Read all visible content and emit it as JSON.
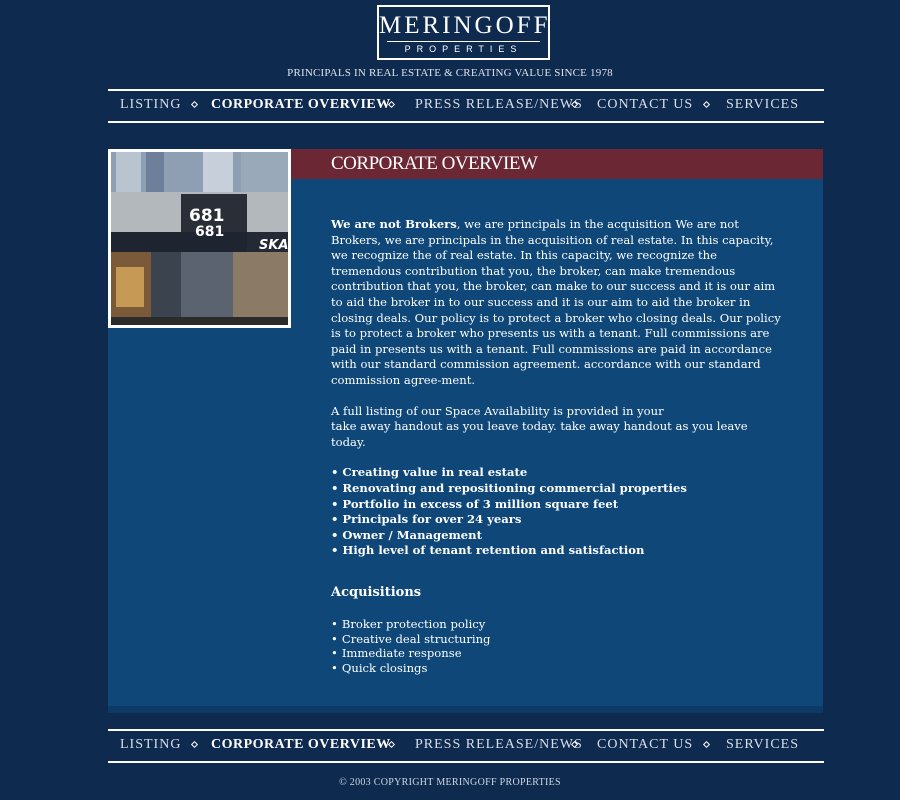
{
  "brand": {
    "name": "MERINGOFF",
    "subname": "PROPERTIES",
    "tagline": "PRINCIPALS IN REAL ESTATE & CREATING VALUE SINCE 1978"
  },
  "nav": {
    "items": [
      {
        "label": "LISTING",
        "active": false
      },
      {
        "label": "CORPORATE OVERVIEW",
        "active": true
      },
      {
        "label": "PRESS RELEASE/NEWS",
        "active": false
      },
      {
        "label": "CONTACT US",
        "active": false
      },
      {
        "label": "SERVICES",
        "active": false
      }
    ]
  },
  "page": {
    "title": "CORPORATE OVERVIEW",
    "intro_bold": "We are not Brokers",
    "intro_text": ", we are principals in the acquisition We are not Brokers, we are principals in the acquisition of real estate. In this capacity, we recognize the of real estate. In this capacity, we recognize the tremendous contribution that you, the broker, can make tremendous contribution that you, the broker, can make to our success and it is our aim to aid the broker in to our success and it is our aim to aid the broker in closing deals. Our policy is to protect a broker who closing deals. Our policy is to protect a broker who presents us with a tenant. Full commissions are paid in presents us with a tenant. Full commissions are paid in accordance with our standard commission agreement. accordance with our standard commission agree-ment.",
    "listing_line1": "A full listing of our Space Availability is provided in your",
    "listing_line2": "take away handout as you leave today. take away handout as you leave today.",
    "features": [
      "Creating value in real estate",
      "Renovating and repositioning commercial properties",
      "Portfolio in excess of 3 million square feet",
      "Principals for over 24 years",
      "Owner / Management",
      "High level of tenant retention and satisfaction"
    ],
    "acquisitions_heading": "Acquisitions",
    "acquisitions": [
      "Broker protection policy",
      "Creative deal structuring",
      "Immediate response",
      "Quick closings"
    ],
    "photo_sign": "681",
    "photo_sign2": "681",
    "photo_store": "SKA"
  },
  "footer": {
    "copyright": "© 2003 COPYRIGHT   MERINGOFF PROPERTIES"
  },
  "colors": {
    "background": "#0f2a4f",
    "panel": "#0e4778",
    "title_bar": "#6b2733"
  }
}
